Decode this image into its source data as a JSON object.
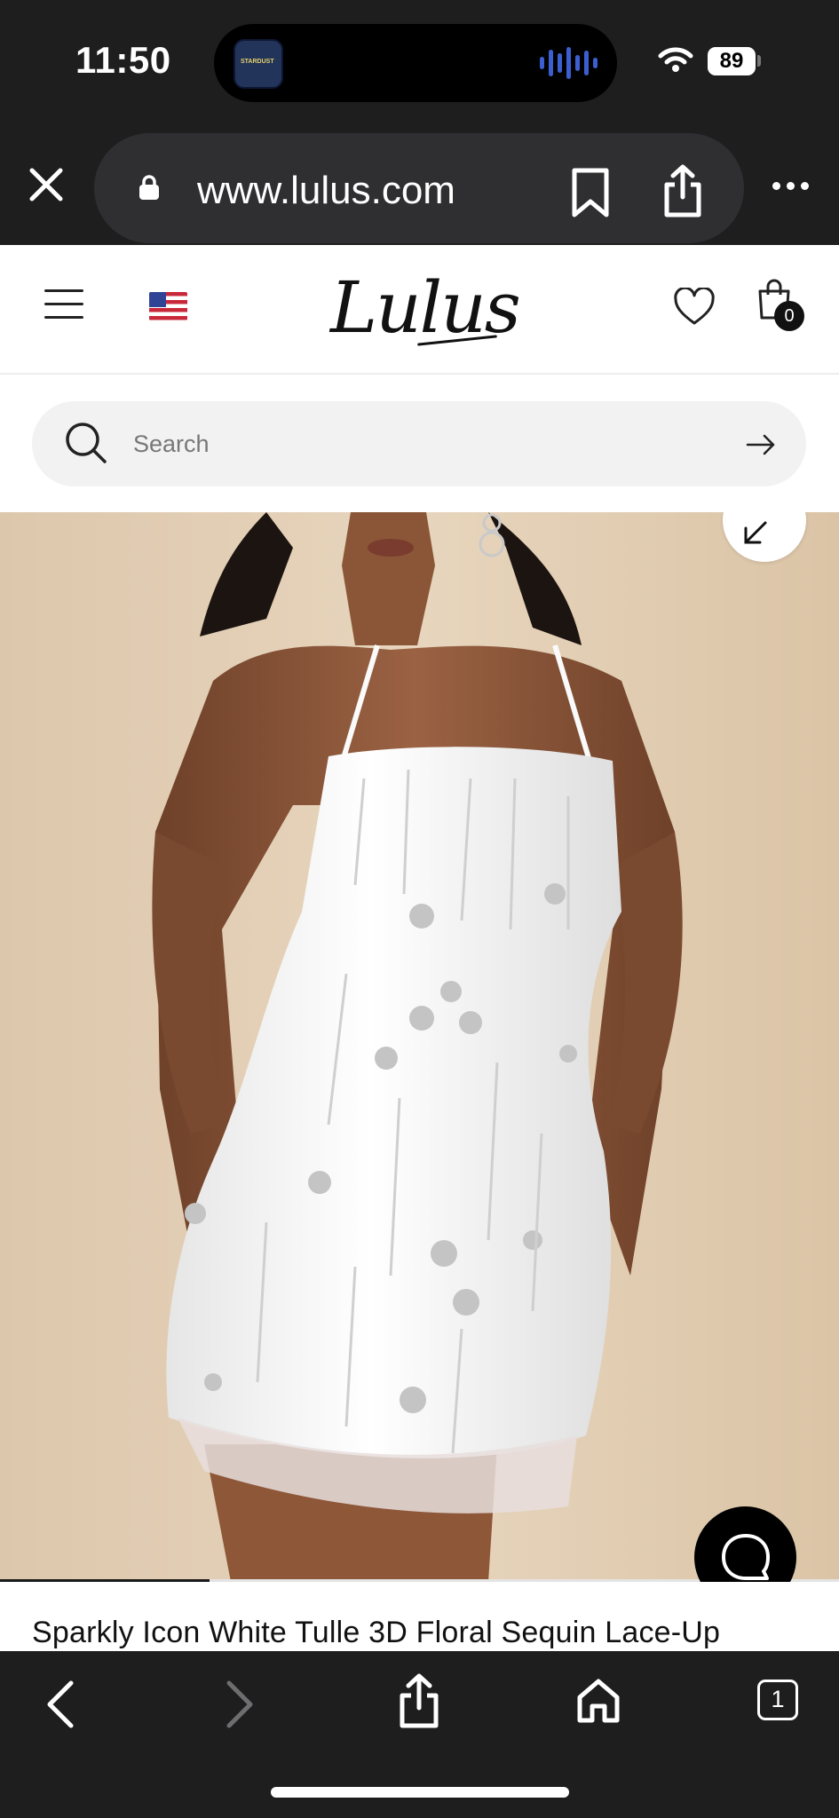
{
  "status_bar": {
    "time": "11:50",
    "island_app_label": "STARDUST",
    "battery": "89"
  },
  "browser": {
    "url": "www.lulus.com"
  },
  "site_header": {
    "logo": "Lulus",
    "cart_count": "0"
  },
  "search": {
    "placeholder": "Search"
  },
  "product": {
    "image_alt": "Model wearing white tulle 3D floral sequin lace-up mini dress",
    "title": "Sparkly Icon White Tulle 3D Floral Sequin Lace-Up",
    "gallery_progress": 0.25
  },
  "toolbar": {
    "tab_count": "1"
  },
  "colors": {
    "browser_chrome": "#1e1e1f",
    "image_bg": "#e2cfb5",
    "accent": "#000000"
  }
}
